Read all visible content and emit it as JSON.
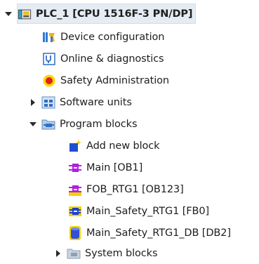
{
  "tree": {
    "plc": {
      "label": "PLC_1 [CPU 1516F-3 PN/DP]"
    },
    "items": {
      "device_config": {
        "label": "Device configuration"
      },
      "online_diag": {
        "label": "Online & diagnostics"
      },
      "safety_admin": {
        "label": "Safety Administration"
      },
      "software_units": {
        "label": "Software units"
      },
      "program_blocks": {
        "label": "Program blocks"
      },
      "add_new_block": {
        "label": "Add new block"
      },
      "main_ob1": {
        "label": "Main [OB1]"
      },
      "fob_rtg1": {
        "label": "FOB_RTG1 [OB123]"
      },
      "main_safety_rtg1": {
        "label": "Main_Safety_RTG1 [FB0]"
      },
      "main_safety_rtg1_db": {
        "label": "Main_Safety_RTG1_DB [DB2]"
      },
      "system_blocks": {
        "label": "System blocks"
      }
    }
  },
  "colors": {
    "arrow": "#2b2b2b",
    "block_magenta": "#b21fe0",
    "block_blue": "#1e3fd1",
    "block_yellow": "#f2d200",
    "db_blue": "#3550d8",
    "safety_red": "#e32020",
    "safety_yellow": "#f8d800",
    "folder": "#5b8bc4"
  }
}
